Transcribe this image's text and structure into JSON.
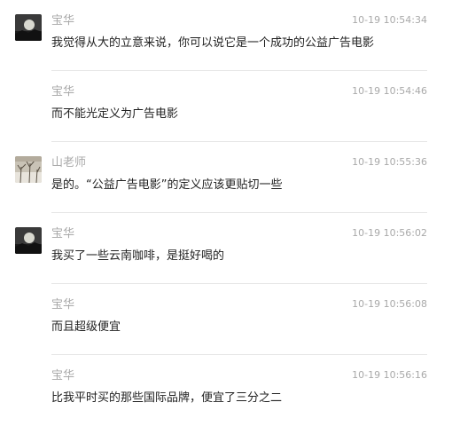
{
  "messages": [
    {
      "sender": "宝华",
      "time": "10-19 10:54:34",
      "text": "我觉得从大的立意来说，你可以说它是一个成功的公益广告电影",
      "avatar": "dark-landscape-avatar"
    },
    {
      "sender": "宝华",
      "time": "10-19 10:54:46",
      "text": "而不能光定义为广告电影",
      "avatar": null
    },
    {
      "sender": "山老师",
      "time": "10-19 10:55:36",
      "text": "是的。“公益广告电影”的定义应该更贴切一些",
      "avatar": "snowy-tree-avatar"
    },
    {
      "sender": "宝华",
      "time": "10-19 10:56:02",
      "text": "我买了一些云南咖啡，是挺好喝的",
      "avatar": "dark-landscape-avatar"
    },
    {
      "sender": "宝华",
      "time": "10-19 10:56:08",
      "text": "而且超级便宜",
      "avatar": null
    },
    {
      "sender": "宝华",
      "time": "10-19 10:56:16",
      "text": "比我平时买的那些国际品牌，便宜了三分之二",
      "avatar": null
    }
  ]
}
